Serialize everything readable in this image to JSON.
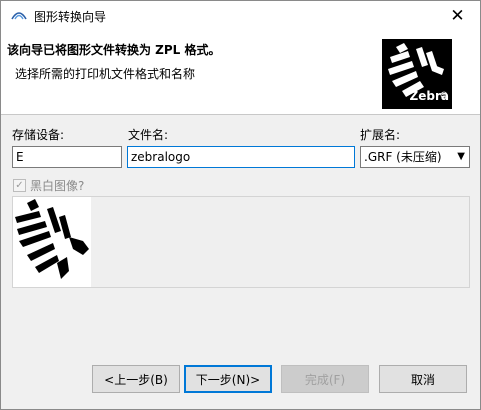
{
  "window": {
    "title": "图形转换向导",
    "close_label": "✕"
  },
  "header": {
    "title": "该向导已将图形文件转换为 ZPL 格式。",
    "subtitle": "选择所需的打印机文件格式和名称",
    "logo_text": "Zebra",
    "logo_registered": "®"
  },
  "form": {
    "storage_label": "存储设备:",
    "storage_value": "E",
    "filename_label": "文件名:",
    "filename_value": "zebralogo",
    "extension_label": "扩展名:",
    "extension_value": ".GRF (未压缩)",
    "bw_label": "黑白图像?",
    "bw_checked": true
  },
  "buttons": {
    "back": "<上一步(B)",
    "next": "下一步(N)>",
    "finish": "完成(F)",
    "cancel": "取消"
  },
  "colors": {
    "accent": "#0078d7"
  }
}
